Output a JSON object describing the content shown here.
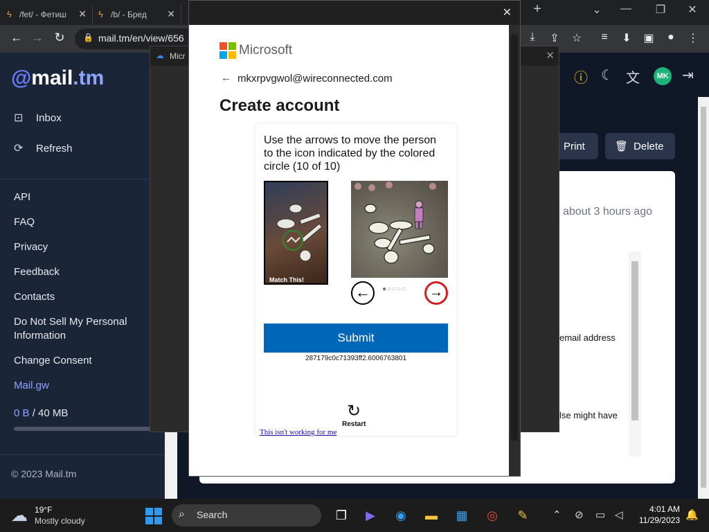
{
  "browser": {
    "tabs": [
      {
        "title": "/fet/ - Фетиш"
      },
      {
        "title": "/b/ - Бред"
      }
    ],
    "new_tab": "+",
    "url": "mail.tm/en/view/656"
  },
  "sidebar": {
    "logo_at": "@",
    "logo_mail": "mail",
    "logo_tm": ".tm",
    "inbox_label": "Inbox",
    "refresh_label": "Refresh",
    "links": [
      "API",
      "FAQ",
      "Privacy",
      "Feedback",
      "Contacts",
      "Do Not Sell My Personal Information",
      "Change Consent"
    ],
    "mail_gw": "Mail.gw",
    "quota_used": "0 B",
    "quota_total": "/ 40 MB",
    "copyright": "© 2023 Mail.tm"
  },
  "header": {
    "avatar_initials": "MK"
  },
  "message": {
    "print_label": "Print",
    "delete_label": "Delete",
    "received": "about 3 hours ago",
    "body_fragment_1": "email address",
    "body_fragment_2": "lse might have"
  },
  "background_dialog": {
    "title": "Micr"
  },
  "popup": {
    "brand": "Microsoft",
    "email": "mkxrpvgwol@wireconnected.com",
    "heading": "Create account",
    "instruction": "Use the arrows to move the person to the icon indicated by the colored circle (10 of 10)",
    "match_label": "Match This!",
    "submit_label": "Submit",
    "session_id": "287179c0c71393ff2.6006763801",
    "restart_label": "Restart",
    "not_working": "This isn't working for me",
    "active_dot_index": 1,
    "dot_count": 5
  },
  "taskbar": {
    "temperature": "19°F",
    "weather": "Mostly cloudy",
    "search_label": "Search",
    "time": "4:01 AM",
    "date": "11/29/2023"
  }
}
